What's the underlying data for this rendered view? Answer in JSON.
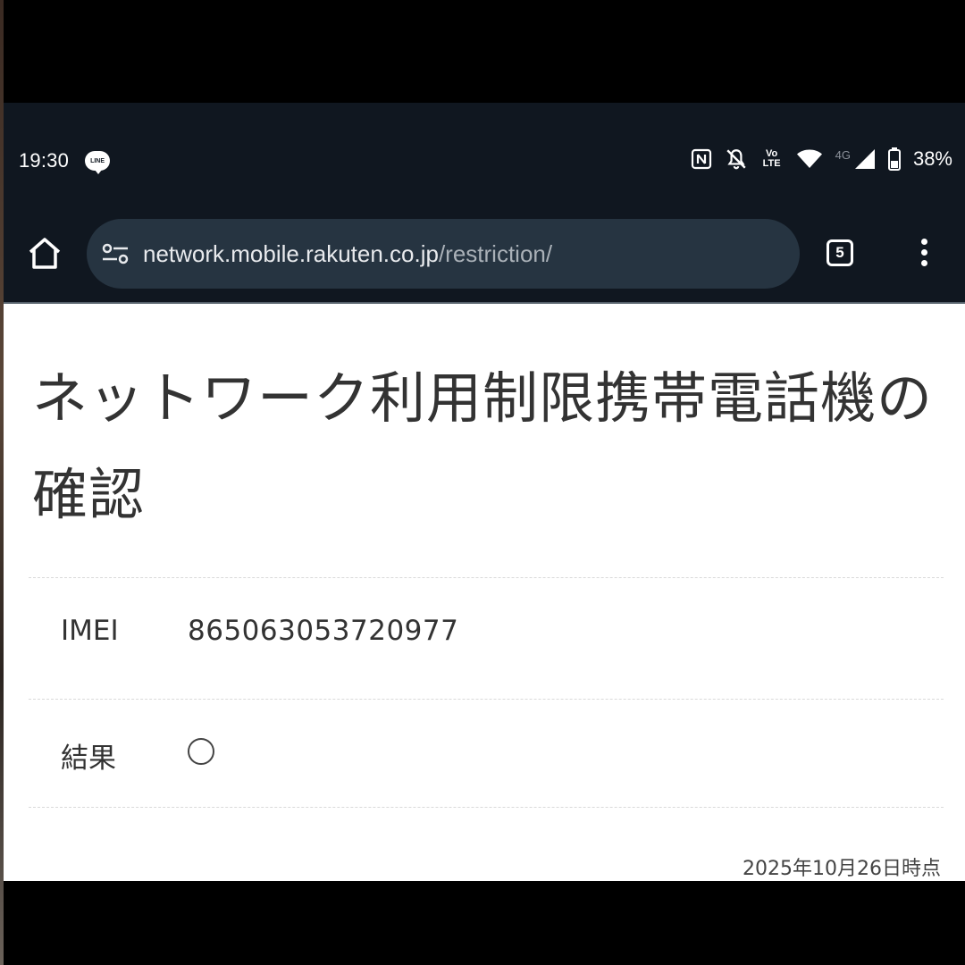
{
  "status_bar": {
    "time": "19:30",
    "line_badge": "LINE",
    "icons": [
      "nfc-icon",
      "bell-off-icon",
      "volte-icon",
      "wifi-icon",
      "signal-icon",
      "battery-icon"
    ],
    "volte_label": "Vo LTE",
    "network_label": "4G",
    "battery_text": "38%"
  },
  "toolbar": {
    "url_host": "network.mobile.rakuten.co.jp",
    "url_path": "/restriction/",
    "tab_count": "5"
  },
  "page": {
    "title": "ネットワーク利用制限携帯電話機の確認",
    "imei_label": "IMEI",
    "imei_value": "865063053720977",
    "result_label": "結果",
    "result_symbol": "〇",
    "timestamp": "2025年10月26日時点"
  }
}
